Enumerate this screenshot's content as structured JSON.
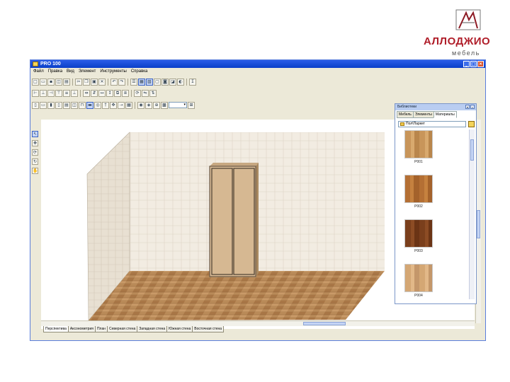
{
  "brand": {
    "name": "АЛЛОДЖИО",
    "subtitle": "мебель",
    "color": "#b01e2a"
  },
  "window": {
    "title": "PRO 100",
    "controls": [
      "minimize",
      "maximize",
      "close"
    ]
  },
  "menu": [
    "Файл",
    "Правка",
    "Вид",
    "Элемент",
    "Инструменты",
    "Справка"
  ],
  "toolbar": {
    "zoom_value": "▾"
  },
  "tabs": [
    {
      "label": "Перспектива",
      "active": true
    },
    {
      "label": "Аксонометрия",
      "active": false
    },
    {
      "label": "План",
      "active": false
    },
    {
      "label": "Северная стена",
      "active": false
    },
    {
      "label": "Западная стена",
      "active": false
    },
    {
      "label": "Южная стена",
      "active": false
    },
    {
      "label": "Восточная стена",
      "active": false
    }
  ],
  "library": {
    "title": "Библиотеки",
    "tabs": [
      {
        "label": "Мебель",
        "active": false
      },
      {
        "label": "Элементы",
        "active": false
      },
      {
        "label": "Материалы",
        "active": true
      }
    ],
    "folder": "Пол\\Паркет",
    "materials": [
      {
        "label": "P001",
        "color": "#c8955a"
      },
      {
        "label": "P002",
        "color": "#b46f34"
      },
      {
        "label": "P003",
        "color": "#7a3f1c"
      },
      {
        "label": "P004",
        "color": "#d4a774"
      }
    ]
  },
  "scene": {
    "wall_color": "#f2ece2",
    "side_wall_color": "#e8e0d2",
    "floor_color": "#b98a58",
    "wardrobe_color": "#d9bb96",
    "wardrobe_frame": "#6b5a48"
  }
}
